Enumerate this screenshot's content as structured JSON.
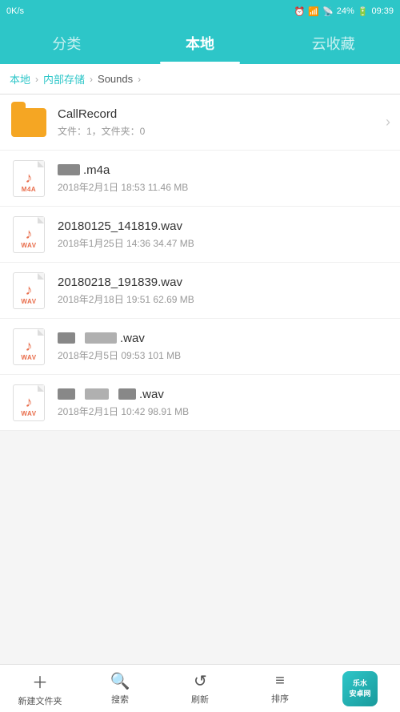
{
  "statusBar": {
    "left": "0K/s",
    "time": "09:39",
    "battery": "24%"
  },
  "nav": {
    "tabs": [
      {
        "id": "fenlei",
        "label": "分类",
        "active": false
      },
      {
        "id": "bendi",
        "label": "本地",
        "active": true
      },
      {
        "id": "yunshoucang",
        "label": "云收藏",
        "active": false
      }
    ]
  },
  "breadcrumb": {
    "items": [
      {
        "label": "本地",
        "id": "bc-local"
      },
      {
        "label": "内部存储",
        "id": "bc-internal"
      },
      {
        "label": "Sounds",
        "id": "bc-sounds"
      }
    ]
  },
  "files": [
    {
      "id": "file-0",
      "type": "folder",
      "name": "CallRecord",
      "meta": "文件：1，文件夹：0",
      "hasChevron": true
    },
    {
      "id": "file-1",
      "type": "audio",
      "ext": "M4A",
      "namePrefix": "BLURRED",
      "nameSuffix": ".m4a",
      "meta": "2018年2月1日  18:53  11.46 MB",
      "hasChevron": false
    },
    {
      "id": "file-2",
      "type": "audio",
      "ext": "WAV",
      "namePrefix": "",
      "nameSuffix": "20180125_141819.wav",
      "meta": "2018年1月25日  14:36  34.47 MB",
      "hasChevron": false
    },
    {
      "id": "file-3",
      "type": "audio",
      "ext": "WAV",
      "namePrefix": "",
      "nameSuffix": "20180218_191839.wav",
      "meta": "2018年2月18日  19:51  62.69 MB",
      "hasChevron": false
    },
    {
      "id": "file-4",
      "type": "audio",
      "ext": "WAV",
      "namePrefix": "BLURRED2",
      "nameSuffix": ".wav",
      "meta": "2018年2月5日  09:53  101 MB",
      "hasChevron": false
    },
    {
      "id": "file-5",
      "type": "audio",
      "ext": "WAV",
      "namePrefix": "BLURRED3",
      "nameSuffix": ".wav",
      "meta": "2018年2月1日  10:42  98.91 MB",
      "hasChevron": false
    }
  ],
  "bottomBar": {
    "buttons": [
      {
        "id": "btn-new",
        "icon": "+",
        "label": "新建文件夹"
      },
      {
        "id": "btn-search",
        "icon": "🔍",
        "label": "搜索"
      },
      {
        "id": "btn-refresh",
        "icon": "↻",
        "label": "刷新"
      },
      {
        "id": "btn-sort",
        "icon": "≡",
        "label": "排序"
      }
    ],
    "logoText": "乐水\n安卓网"
  }
}
